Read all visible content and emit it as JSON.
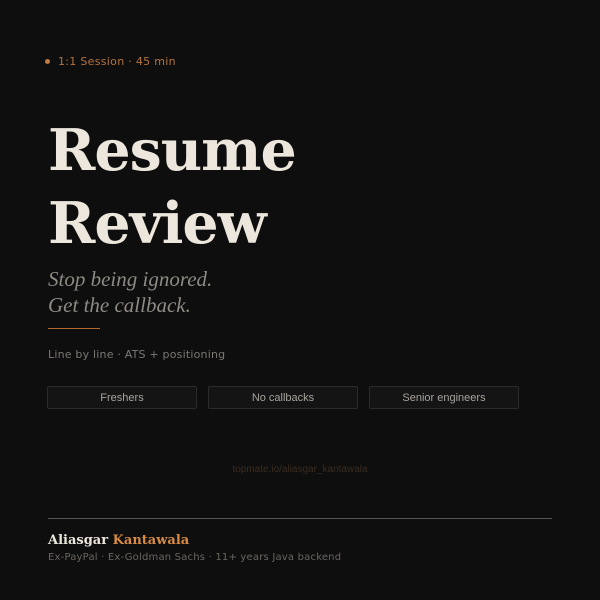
{
  "session": {
    "label": "1:1 Session · 45 min",
    "accent_color": "#c07a3f"
  },
  "title": {
    "line1": "Resume",
    "line2": "Review"
  },
  "tagline": {
    "line1": "Stop being ignored.",
    "line2": "Get the callback."
  },
  "description": "Line by line · ATS + positioning",
  "audience_tags": [
    "Freshers",
    "No callbacks",
    "Senior engineers"
  ],
  "booking_link": "topmate.io/aliasgar_kantawala",
  "author": {
    "first_name": "Aliasgar",
    "last_name": "Kantawala",
    "credentials": "Ex-PayPal · Ex-Goldman Sachs · 11+ years Java backend"
  },
  "colors": {
    "background": "#0e0e0e",
    "accent": "#d68a44",
    "title_text": "#ece6dc"
  }
}
